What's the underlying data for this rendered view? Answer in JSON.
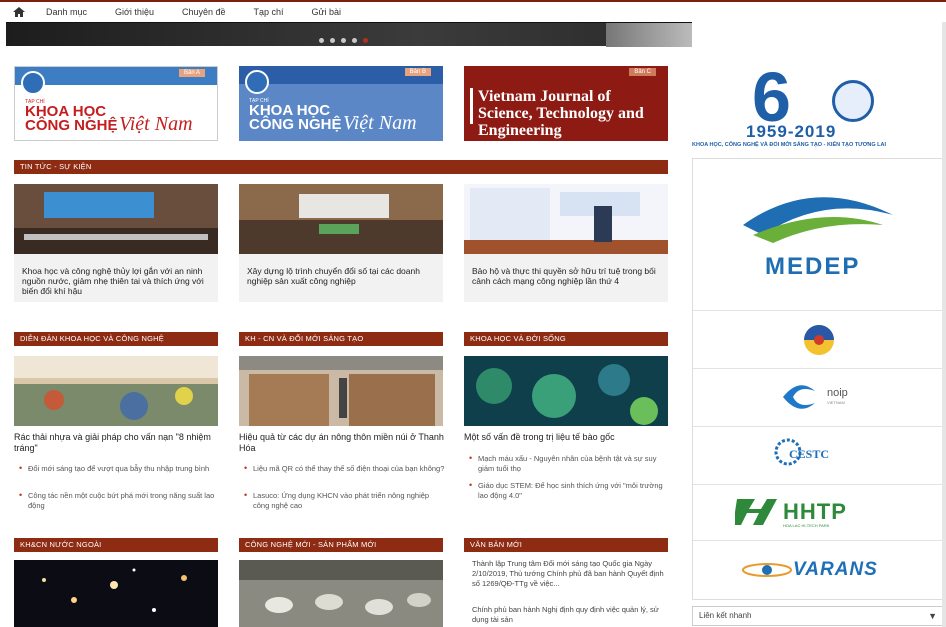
{
  "nav": {
    "items": [
      "Danh mục",
      "Giới thiệu",
      "Chuyên đề",
      "Tạp chí",
      "Gửi bài"
    ]
  },
  "slider": {
    "dot_count": 5,
    "active_dot": 5
  },
  "journals": {
    "a": {
      "badge": "Bản A",
      "tc": "TẠP CHÍ",
      "line1": "KHOA HỌC",
      "line2": "CÔNG NGHỆ",
      "vn": "Việt Nam"
    },
    "b": {
      "badge": "Bản B",
      "tc": "TẠP CHÍ",
      "line1": "KHOA HỌC",
      "line2": "CÔNG NGHỆ",
      "vn": "Việt Nam"
    },
    "c": {
      "badge": "Bản C",
      "title": "Vietnam Journal of Science, Technology and Engineering"
    }
  },
  "news": {
    "header": "TIN TỨC - SỰ KIỆN",
    "items": [
      "Khoa học và công nghệ thủy lợi gắn với an ninh nguồn nước, giảm nhẹ thiên tai và thích ứng với biến đổi khí hậu",
      "Xây dựng lộ trình chuyển đổi số tại các doanh nghiệp sản xuất công nghiệp",
      "Bảo hộ và thực thi quyền sở hữu trí tuệ trong bối cảnh cách mạng công nghiệp lần thứ 4"
    ]
  },
  "columns": [
    {
      "header": "DIỄN ĐÀN KHOA HỌC VÀ CÔNG NGHỆ",
      "title": "Rác thải nhựa và giải pháp cho vấn nạn \"8 nhiệm tráng\"",
      "bullets": [
        "Đổi mới sáng tạo để vượt qua bẫy thu nhập trung bình",
        "Công tác nền một cuộc bứt phá mới trong năng suất lao động"
      ]
    },
    {
      "header": "KH - CN VÀ ĐỔI MỚI SÁNG TẠO",
      "title": "Hiệu quả từ các dự án nông thôn miền núi ở Thanh Hóa",
      "bullets": [
        "Liệu mã QR có thể thay thế số điện thoại của bạn không?",
        "Lasuco: Ứng dụng KHCN vào phát triển nông nghiệp công nghệ cao"
      ]
    },
    {
      "header": "KHOA HỌC VÀ ĐỜI SỐNG",
      "title": "Một số vấn đề trong trị liệu tế bào gốc",
      "bullets": [
        "Mạch máu xấu - Nguyên nhân của bệnh tật và sự suy giảm tuổi thọ",
        "Giáo dục STEM: Để học sinh thích ứng với \"môi trường lao động 4.0\""
      ]
    }
  ],
  "bottom": {
    "h1": "KH&CN NƯỚC NGOÀI",
    "h2": "CÔNG NGHỆ MỚI - SẢN PHẨM MỚI",
    "h3": "VĂN BẢN MỚI",
    "doc1": "Thành lập Trung tâm Đổi mới sáng tạo Quốc gia Ngày 2/10/2019, Thủ tướng Chính phủ đã ban hành Quyết định số 1269/QĐ-TTg về việc...",
    "doc2": "Chính phủ ban hành Nghị định quy định việc quản lý, sử dụng tài sản"
  },
  "sidebar": {
    "anniv": {
      "sixty": "6",
      "years": "1959-2019",
      "tagline": "KHOA HỌC, CÔNG NGHỆ VÀ ĐỔI MỚI SÁNG TẠO - KIẾN TẠO TƯƠNG LAI"
    },
    "medep": "MEDEP",
    "noip": "noip",
    "noip_sub": "VIETNAM",
    "cestc": "CESTC",
    "hhtp": "HHTP",
    "hhtp_sub": "HOA LAC HI-TECH PARK",
    "varans": "VARANS"
  },
  "quicklinks": {
    "label": "Liên kết nhanh",
    "caret": "▼"
  }
}
